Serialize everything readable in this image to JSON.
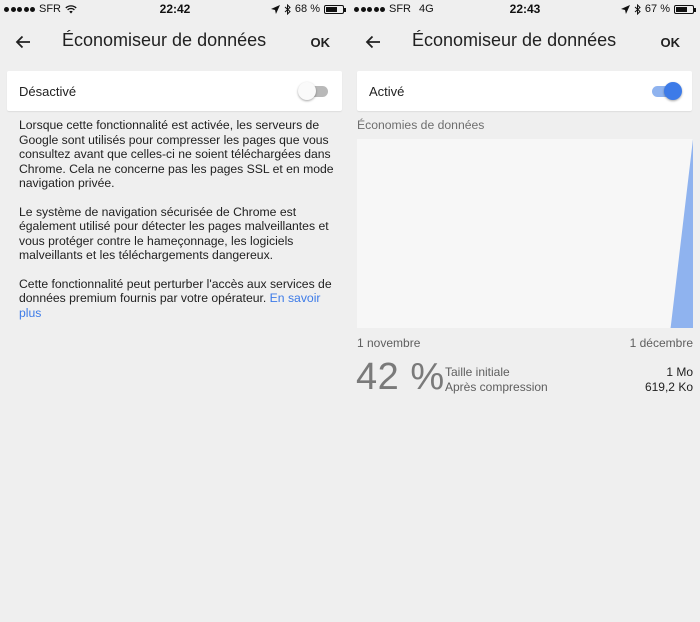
{
  "left": {
    "status": {
      "carrier": "SFR",
      "time": "22:42",
      "battery": "68 %",
      "battery_level": 0.68
    },
    "header": {
      "title": "Économiseur de données",
      "ok_label": "OK"
    },
    "toggle": {
      "label": "Désactivé",
      "state": "off"
    },
    "description": {
      "p1": "Lorsque cette fonctionnalité est activée, les serveurs de Google sont utilisés pour compresser les pages que vous consultez avant que celles-ci ne soient téléchargées dans Chrome. Cela ne concerne pas les pages SSL et en mode navigation privée.",
      "p2": "Le système de navigation sécurisée de Chrome est également utilisé pour détecter les pages malveillantes et vous protéger contre le hameçonnage, les logiciels malveillants et les téléchargements dangereux.",
      "p3": "Cette fonctionnalité peut perturber l'accès aux services de données premium fournis par votre opérateur. ",
      "link": "En savoir plus"
    }
  },
  "right": {
    "status": {
      "carrier": "SFR",
      "network": "4G",
      "time": "22:43",
      "battery": "67 %",
      "battery_level": 0.67
    },
    "header": {
      "title": "Économiseur de données",
      "ok_label": "OK"
    },
    "toggle": {
      "label": "Activé",
      "state": "on"
    },
    "savings": {
      "title": "Économies de données",
      "start_label": "1 novembre",
      "end_label": "1 décembre",
      "percent": "42 %",
      "initial_label": "Taille initiale",
      "compressed_label": "Après compression",
      "initial_value": "1 Mo",
      "compressed_value": "619,2 Ko"
    }
  },
  "chart_data": {
    "type": "area",
    "x_start": "1 novembre",
    "x_end": "1 décembre",
    "days": 30,
    "series": [
      {
        "values": [
          0,
          0,
          0,
          0,
          0,
          0,
          0,
          0,
          0,
          0,
          0,
          0,
          0,
          0,
          0,
          0,
          0,
          0,
          0,
          0,
          0,
          0,
          0,
          0,
          0,
          0,
          0,
          0,
          0,
          0.5,
          1.0
        ]
      },
      {
        "values": [
          0,
          0,
          0,
          0,
          0,
          0,
          0,
          0,
          0,
          0,
          0,
          0,
          0,
          0,
          0,
          0,
          0,
          0,
          0,
          0,
          0,
          0,
          0,
          0,
          0,
          0,
          0,
          0,
          0,
          0.3,
          0.6
        ]
      }
    ],
    "ylim": [
      0,
      1
    ],
    "grid": false
  },
  "colors": {
    "accent": "#3d7be8",
    "area_primary": "#8fb3ef",
    "area_secondary": "#c9cfd9"
  },
  "icons": {
    "back": "arrow-left-icon",
    "wifi": "wifi-icon",
    "location": "location-arrow-icon",
    "bluetooth": "bluetooth-icon"
  }
}
